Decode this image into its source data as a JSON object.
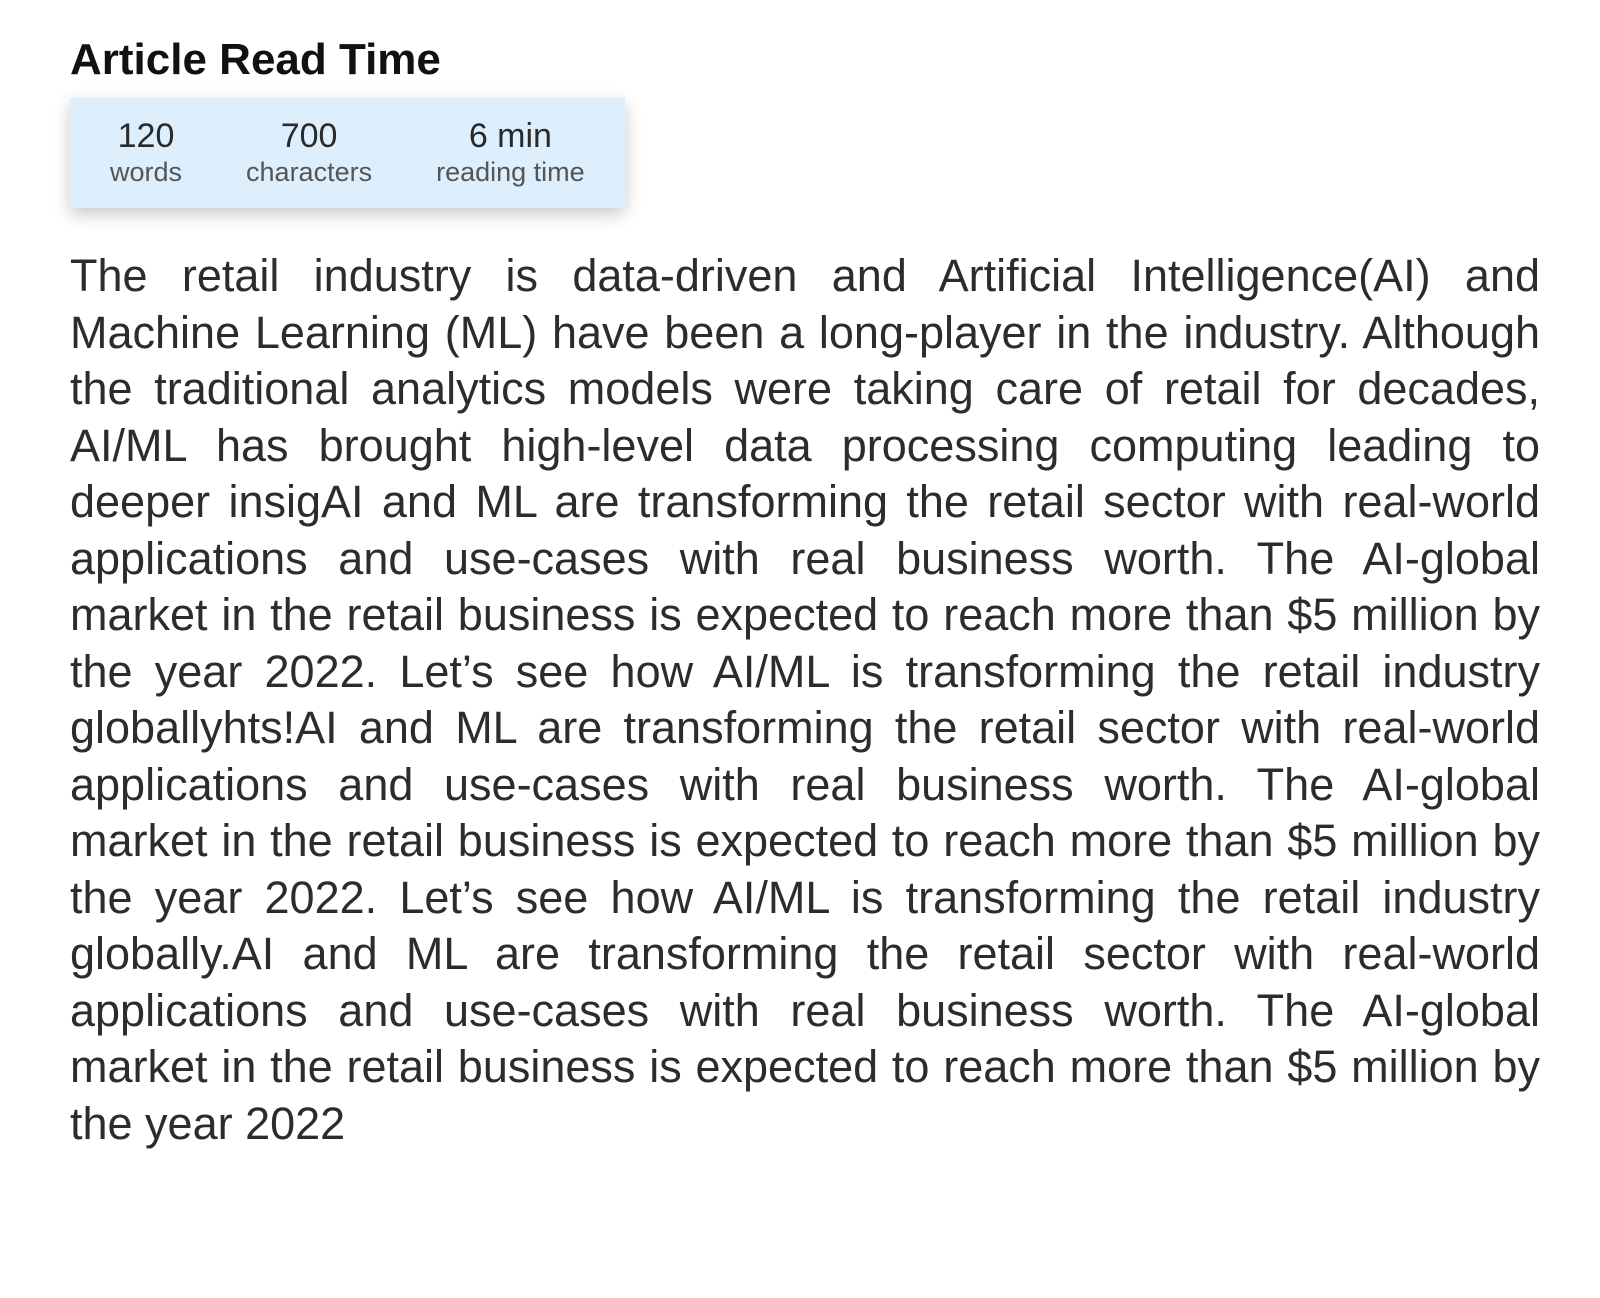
{
  "header": {
    "title": "Article Read Time"
  },
  "stats": [
    {
      "value": "120",
      "label": "words"
    },
    {
      "value": "700",
      "label": "characters"
    },
    {
      "value": "6 min",
      "label": "reading time"
    }
  ],
  "article": {
    "text": "The retail industry is data-driven and Artificial Intelligence(AI) and Machine Learning (ML) have been a long-player in the industry. Although the traditional analytics models were taking care of retail for decades, AI/ML has brought high-level data processing computing leading to deeper insigAI and ML are transforming the retail sector with real-world applications and use-cases with real business worth. The AI-global market in the retail business is expected to reach more than $5 million by the year 2022. Let’s see how AI/ML is transforming the retail industry globallyhts!AI and ML are transforming the retail sector with real-world applications and use-cases with real business worth. The AI-global market in the retail business is expected to reach more than $5 million by the year 2022. Let’s see how AI/ML is transforming the retail industry globally.AI and ML are transforming the retail sector with real-world applications and use-cases with real business worth. The AI-global market in the retail business is expected to reach more than $5 million by the year 2022"
  },
  "colors": {
    "card_background": "#ddeefc",
    "title": "#111111",
    "body_text": "#2c2c2c"
  }
}
